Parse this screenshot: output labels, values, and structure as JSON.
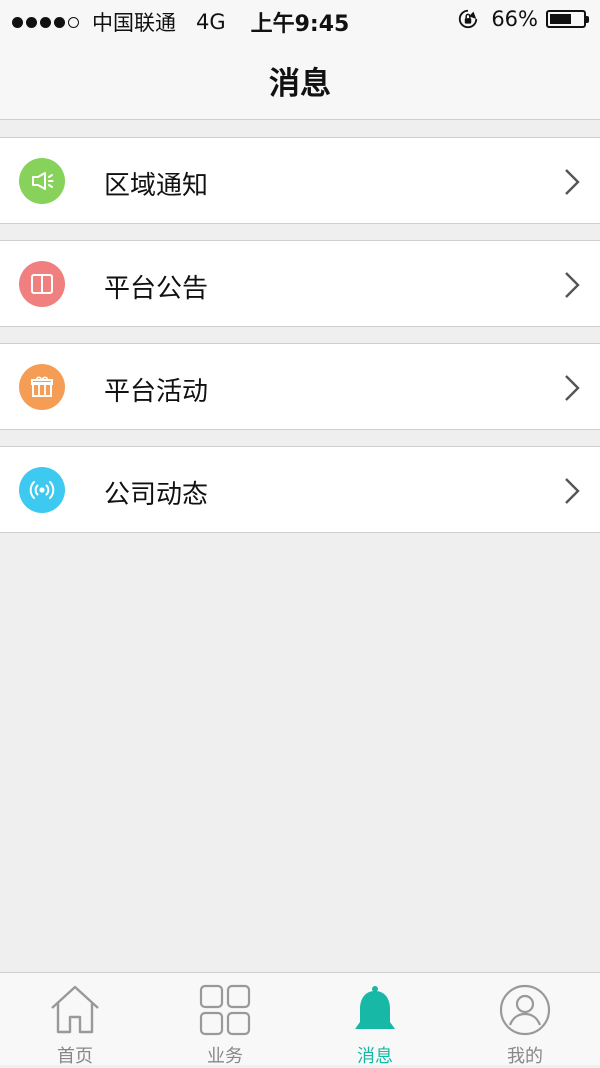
{
  "status_bar": {
    "carrier": "中国联通",
    "network": "4G",
    "time": "上午9:45",
    "battery": "66%",
    "battery_level": 0.66
  },
  "header": {
    "title": "消息"
  },
  "menu": {
    "items": [
      {
        "label": "区域通知",
        "icon": "megaphone-icon",
        "color": "#86d25a"
      },
      {
        "label": "平台公告",
        "icon": "book-icon",
        "color": "#f08080"
      },
      {
        "label": "平台活动",
        "icon": "gift-icon",
        "color": "#f59d54"
      },
      {
        "label": "公司动态",
        "icon": "broadcast-icon",
        "color": "#3ec9f0"
      }
    ]
  },
  "tabbar": {
    "tabs": [
      {
        "label": "首页",
        "icon": "home-icon",
        "active": false
      },
      {
        "label": "业务",
        "icon": "grid-icon",
        "active": false
      },
      {
        "label": "消息",
        "icon": "bell-icon",
        "active": true
      },
      {
        "label": "我的",
        "icon": "user-icon",
        "active": false
      }
    ],
    "accent_color": "#18b8a6",
    "inactive_color": "#888888"
  }
}
